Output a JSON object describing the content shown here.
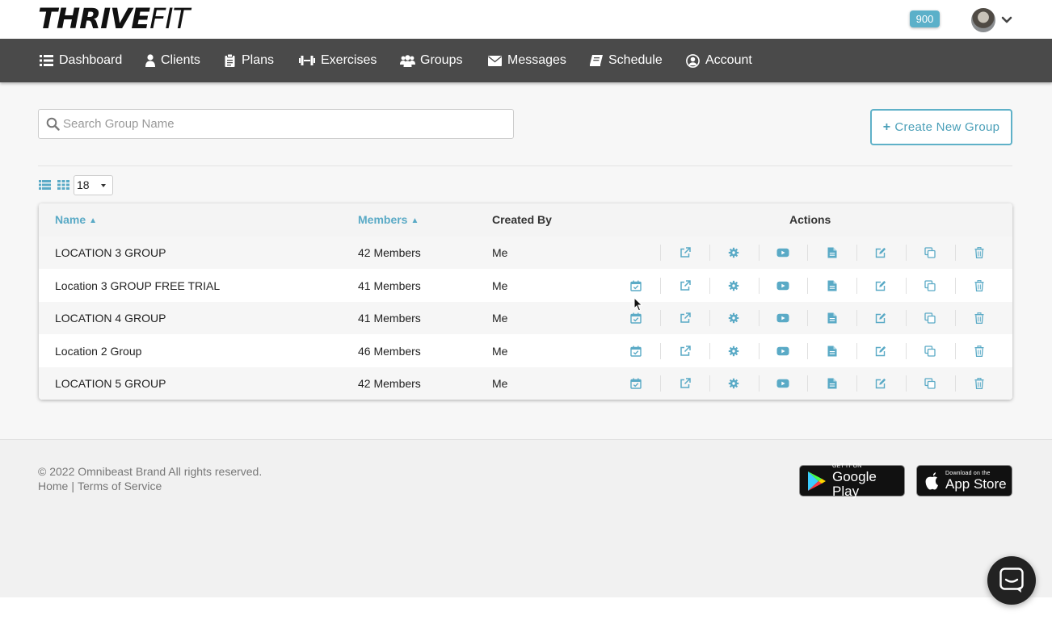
{
  "brand": {
    "logo_bold": "THRIVE",
    "logo_thin": "FIT"
  },
  "header": {
    "badge": "900",
    "avatar_icon": "user-avatar",
    "menu_icon": "chevron-down-icon"
  },
  "nav": {
    "items": [
      {
        "label": "Dashboard",
        "icon": "list-icon"
      },
      {
        "label": "Clients",
        "icon": "user-icon"
      },
      {
        "label": "Plans",
        "icon": "clipboard-icon"
      },
      {
        "label": "Exercises",
        "icon": "dumbbell-icon"
      },
      {
        "label": "Groups",
        "icon": "users-icon"
      },
      {
        "label": "Messages",
        "icon": "envelope-icon"
      },
      {
        "label": "Schedule",
        "icon": "book-icon"
      },
      {
        "label": "Account",
        "icon": "user-circle-icon"
      }
    ]
  },
  "search": {
    "placeholder": "Search Group Name",
    "value": ""
  },
  "create_button": {
    "label": "Create New Group"
  },
  "view": {
    "per_page": "18"
  },
  "table": {
    "headers": {
      "name": "Name",
      "members": "Members",
      "created_by": "Created By",
      "actions": "Actions"
    },
    "rows": [
      {
        "name": "LOCATION 3 GROUP",
        "members": "42 Members",
        "created_by": "Me",
        "has_schedule": false
      },
      {
        "name": "Location 3 GROUP FREE TRIAL",
        "members": "41 Members",
        "created_by": "Me",
        "has_schedule": true
      },
      {
        "name": "LOCATION 4 GROUP",
        "members": "41 Members",
        "created_by": "Me",
        "has_schedule": true
      },
      {
        "name": "Location 2 Group",
        "members": "46 Members",
        "created_by": "Me",
        "has_schedule": true
      },
      {
        "name": "LOCATION 5 GROUP",
        "members": "42 Members",
        "created_by": "Me",
        "has_schedule": true
      }
    ],
    "action_icons": [
      "calendar-check-icon",
      "external-link-icon",
      "gear-icon",
      "video-icon",
      "document-icon",
      "edit-icon",
      "copy-icon",
      "trash-icon"
    ]
  },
  "footer": {
    "copyright": "© 2022 Omnibeast Brand All rights reserved.",
    "home_link": "Home",
    "separator": "|",
    "terms_link": "Terms of Service",
    "google_play": {
      "small": "GET IT ON",
      "big": "Google Play"
    },
    "app_store": {
      "small": "Download on the",
      "big": "App Store"
    }
  },
  "colors": {
    "accent": "#5aaac6",
    "nav_bg": "#4a4a4a",
    "badge": "#5bb0c9"
  }
}
